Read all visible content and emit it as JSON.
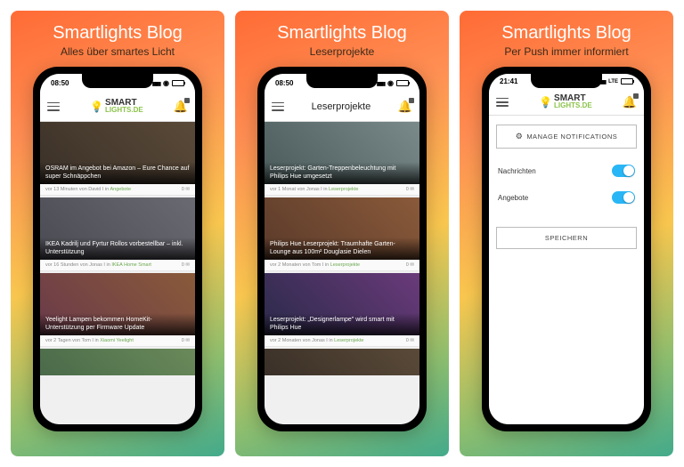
{
  "panels": [
    {
      "title": "Smartlights Blog",
      "subtitle": "Alles über smartes Licht"
    },
    {
      "title": "Smartlights Blog",
      "subtitle": "Leserprojekte"
    },
    {
      "title": "Smartlights Blog",
      "subtitle": "Per Push immer informiert"
    }
  ],
  "brand": {
    "top": "SMART",
    "bottom": "LIGHTS.DE"
  },
  "status": {
    "time1": "08:50",
    "time2": "08:50",
    "time3": "21:41",
    "lte": "LTE"
  },
  "screen2_title": "Leserprojekte",
  "feed1": [
    {
      "headline": "OSRAM im Angebot bei Amazon – Eure Chance auf super Schnäppchen",
      "meta_left": "vor 13 Minuten von David I in",
      "meta_cat": "Angebote",
      "meta_right": "0 ✉"
    },
    {
      "headline": "IKEA Kadrilj und Fyrtur Rollos vorbestellbar – inkl. Unterstützung",
      "meta_left": "vor 16 Stunden von Jonas I in",
      "meta_cat": "IKEA Home Smart",
      "meta_right": "0 ✉"
    },
    {
      "headline": "Yeelight Lampen bekommen HomeKit-Unterstützung per Firmware Update",
      "meta_left": "vor 2 Tagen von Tom I in",
      "meta_cat": "Xiaomi Yeelight",
      "meta_right": "0 ✉"
    }
  ],
  "feed2": [
    {
      "headline": "Leserprojekt: Garten-Treppenbeleuchtung mit Philips Hue umgesetzt",
      "meta_left": "vor 1 Monat von Jonas I in",
      "meta_cat": "Leserprojekte",
      "meta_right": "0 ✉"
    },
    {
      "headline": "Philips Hue Leserprojekt: Traumhafte Garten-Lounge aus 100m² Douglasie Dielen",
      "meta_left": "vor 2 Monaten von Tom I in",
      "meta_cat": "Leserprojekte",
      "meta_right": "0 ✉"
    },
    {
      "headline": "Leserprojekt: „Designerlampe\" wird smart mit Philips Hue",
      "meta_left": "vor 2 Monaten von Jonas I in",
      "meta_cat": "Leserprojekte",
      "meta_right": "0 ✉"
    }
  ],
  "settings": {
    "manage": "MANAGE NOTIFICATIONS",
    "row1": "Nachrichten",
    "row2": "Angebote",
    "save": "SPEICHERN"
  }
}
